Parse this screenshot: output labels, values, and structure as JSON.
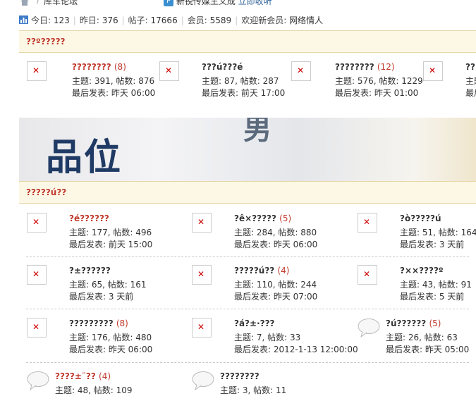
{
  "topbar": {
    "crumb": "库车论坛",
    "notice": "新锐传媒王义成",
    "notice_link": "立即收听"
  },
  "stats": {
    "today_label": "今日:",
    "today": "123",
    "yesterday_label": "昨日:",
    "yesterday": "376",
    "posts_label": "帖子:",
    "posts": "17666",
    "members_label": "会员:",
    "members": "5589",
    "welcome_label": "欢迎新会员:",
    "new_member": "网络情人"
  },
  "section1": {
    "title": "??º?????",
    "forums": [
      {
        "name": "????????",
        "count": "(8)",
        "stats": "主题: 391, 帖数: 876",
        "last": "最后发表: 昨天 06:00"
      },
      {
        "name": "???ú???é",
        "count": "",
        "stats": "主题: 87, 帖数: 287",
        "last": "最后发表: 前天 17:00"
      },
      {
        "name": "????????",
        "count": "(12)",
        "stats": "主题: 576, 帖数: 1229",
        "last": "最后发表: 昨天 01:00"
      },
      {
        "name": "??",
        "count": "",
        "stats": "主题",
        "last": "最后"
      }
    ]
  },
  "banner": {
    "text": "品位",
    "frag": "男"
  },
  "section2": {
    "title": "?????ú??",
    "forums": [
      {
        "name": "?é??????",
        "count": "",
        "stats": "主题: 177, 帖数: 496",
        "last": "最后发表: 前天 15:00"
      },
      {
        "name": "?ê×?????",
        "count": "(5)",
        "stats": "主题: 284, 帖数: 880",
        "last": "最后发表: 昨天 06:00"
      },
      {
        "name": "?ò?????ú",
        "count": "",
        "stats": "主题: 51, 帖数: 164",
        "last": "最后发表: 3 天前"
      },
      {
        "name": "?±??????",
        "count": "",
        "stats": "主题: 65, 帖数: 161",
        "last": "最后发表: 3 天前"
      },
      {
        "name": "?????ú??",
        "count": "(4)",
        "stats": "主题: 110, 帖数: 244",
        "last": "最后发表: 昨天 07:00"
      },
      {
        "name": "?××????º",
        "count": "",
        "stats": "主题: 43, 帖数: 91",
        "last": "最后发表: 5 天前"
      },
      {
        "name": "?????????",
        "count": "(8)",
        "stats": "主题: 176, 帖数: 480",
        "last": "最后发表: 昨天 06:00"
      },
      {
        "name": "?á?±·???",
        "count": "",
        "stats": "主题: 7, 帖数: 33",
        "last": "最后发表: 2012-1-13 12:00:00"
      },
      {
        "name": "?ú??????",
        "count": "(5)",
        "stats": "主题: 26, 帖数: 63",
        "last": "最后发表: 昨天 05:00"
      },
      {
        "name": "????±¨??",
        "count": "(4)",
        "stats": "主题: 48, 帖数: 109",
        "last": ""
      },
      {
        "name": "????????",
        "count": "",
        "stats": "主题: 3, 帖数: 11",
        "last": ""
      }
    ]
  }
}
